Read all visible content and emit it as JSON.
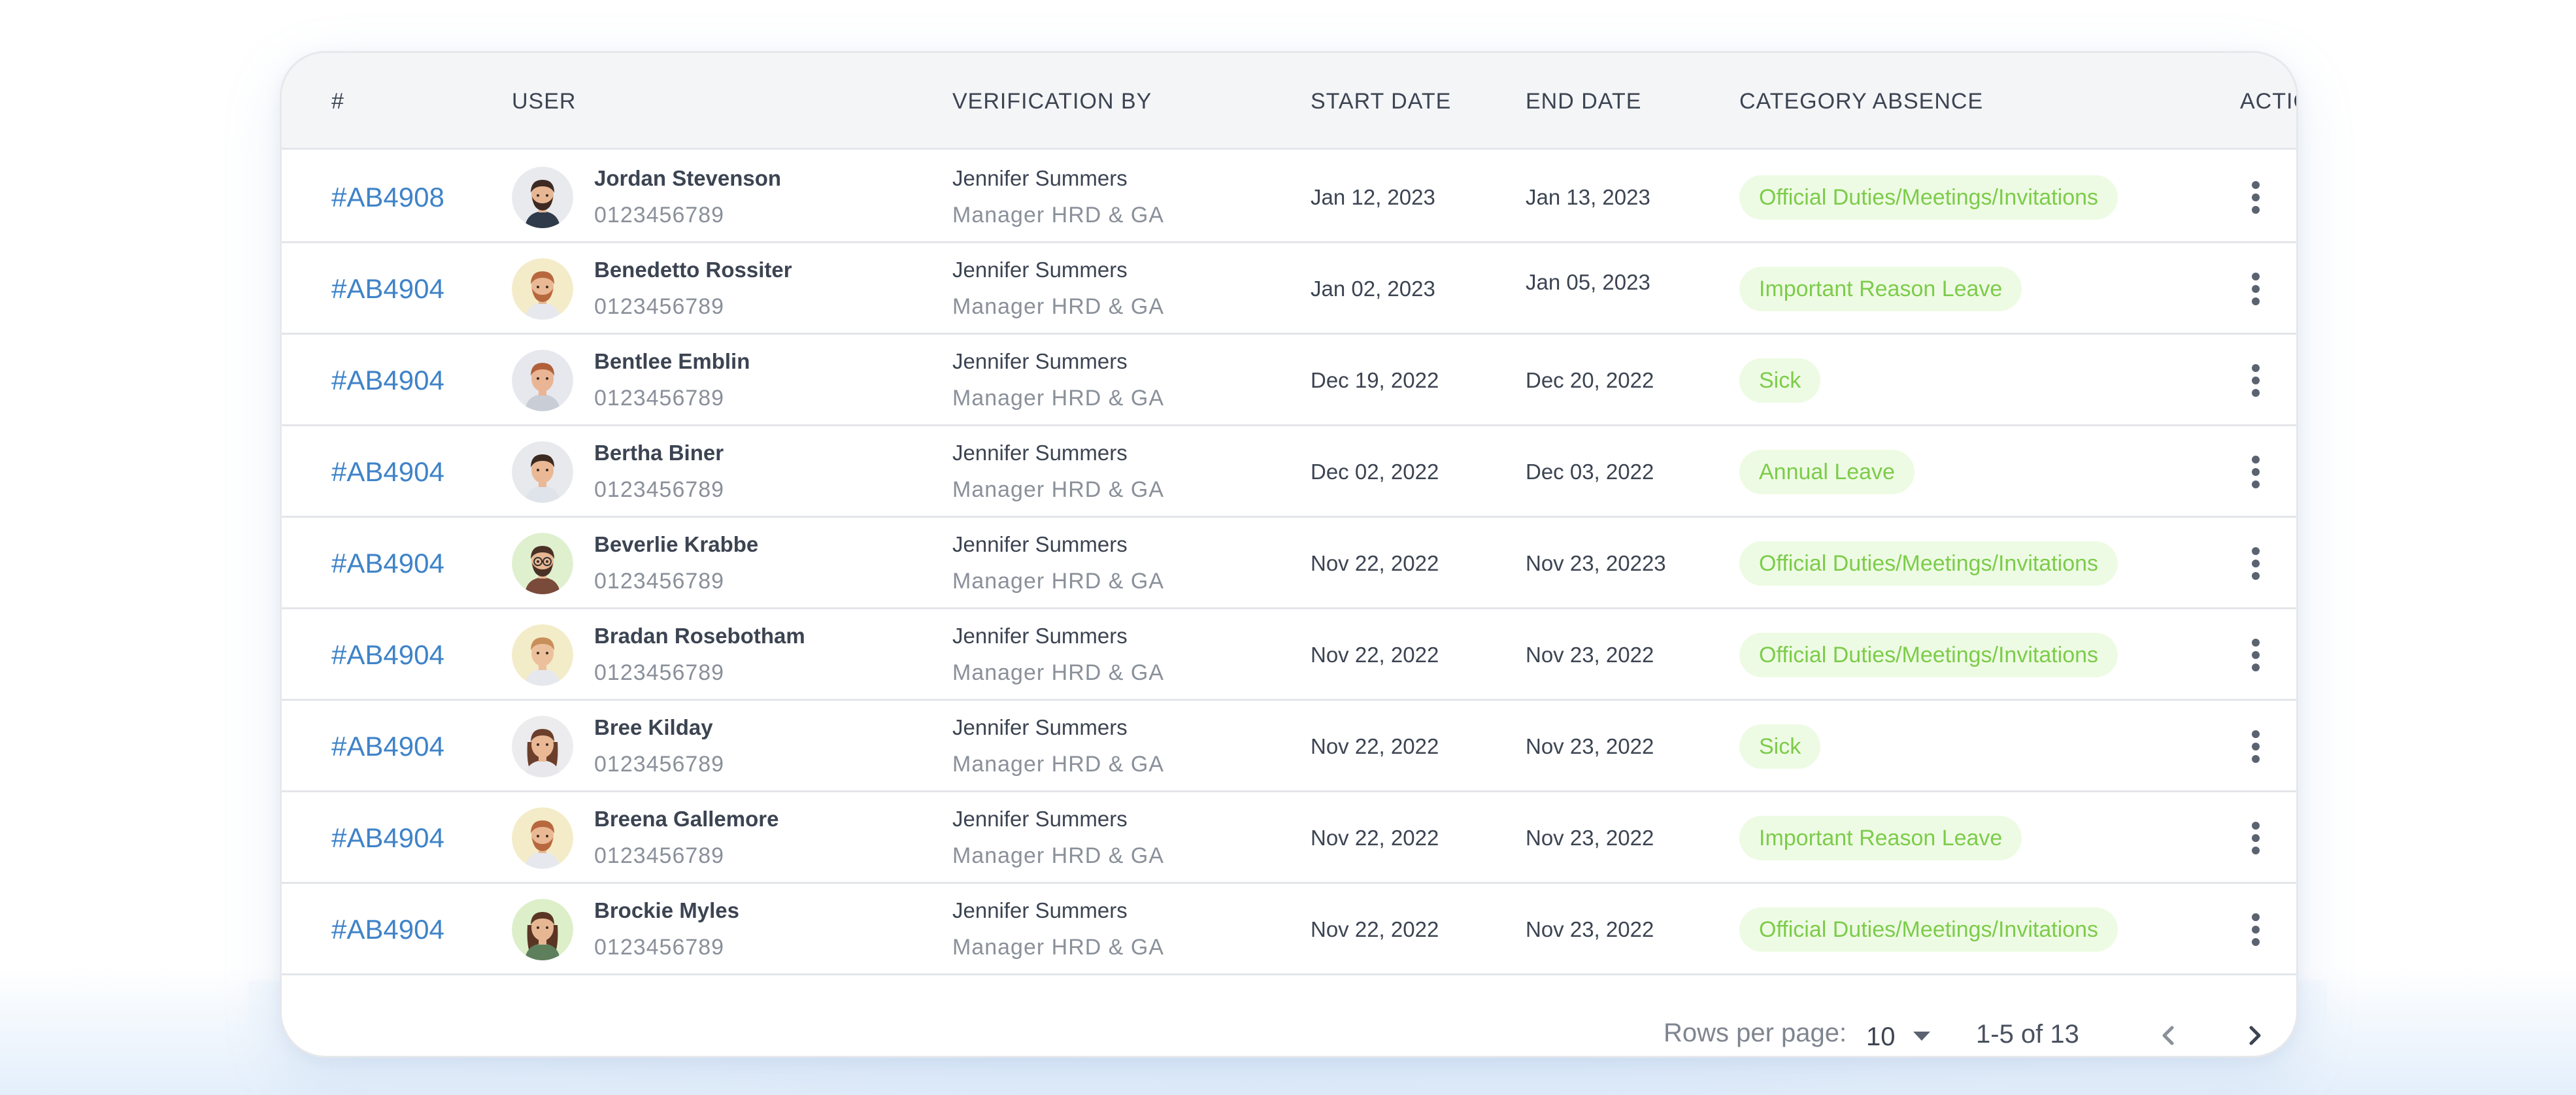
{
  "colors": {
    "accent_link": "#3f83c8",
    "badge_bg": "#eefbe4",
    "badge_text": "#7ccc4a",
    "header_bg": "#f4f5f7"
  },
  "table": {
    "columns": [
      "#",
      "USER",
      "VERIFICATION BY",
      "START DATE",
      "END DATE",
      "CATEGORY ABSENCE",
      "ACTION"
    ],
    "rows": [
      {
        "id": "#AB4908",
        "user_name": "Jordan Stevenson",
        "user_phone": "0123456789",
        "verifier_name": "Jennifer Summers",
        "verifier_role": "Manager HRD & GA",
        "start_date": "Jan 12, 2023",
        "end_date": "Jan 13, 2023",
        "category": "Official Duties/Meetings/Invitations",
        "avatar_icon": "avatar-man-beard-dark-icon"
      },
      {
        "id": "#AB4904",
        "user_name": "Benedetto Rossiter",
        "user_phone": "0123456789",
        "verifier_name": "Jennifer Summers",
        "verifier_role": "Manager HRD & GA",
        "start_date": "Jan 02, 2023",
        "end_date": "Jan 05, 2023",
        "category": "Important Reason Leave",
        "avatar_icon": "avatar-man-ginger-beard-icon"
      },
      {
        "id": "#AB4904",
        "user_name": "Bentlee Emblin",
        "user_phone": "0123456789",
        "verifier_name": "Jennifer Summers",
        "verifier_role": "Manager HRD & GA",
        "start_date": "Dec 19, 2022",
        "end_date": "Dec 20, 2022",
        "category": "Sick",
        "avatar_icon": "avatar-man-ginger-icon"
      },
      {
        "id": "#AB4904",
        "user_name": "Bertha Biner",
        "user_phone": "0123456789",
        "verifier_name": "Jennifer Summers",
        "verifier_role": "Manager HRD & GA",
        "start_date": "Dec 02, 2022",
        "end_date": "Dec 03, 2022",
        "category": "Annual Leave",
        "avatar_icon": "avatar-man-dark-hair-icon"
      },
      {
        "id": "#AB4904",
        "user_name": "Beverlie Krabbe",
        "user_phone": "0123456789",
        "verifier_name": "Jennifer Summers",
        "verifier_role": "Manager HRD & GA",
        "start_date": "Nov 22, 2022",
        "end_date": "Nov 23, 20223",
        "category": "Official Duties/Meetings/Invitations",
        "avatar_icon": "avatar-man-glasses-icon"
      },
      {
        "id": "#AB4904",
        "user_name": "Bradan Rosebotham",
        "user_phone": "0123456789",
        "verifier_name": "Jennifer Summers",
        "verifier_role": "Manager HRD & GA",
        "start_date": "Nov 22, 2022",
        "end_date": "Nov 23, 2022",
        "category": "Official Duties/Meetings/Invitations",
        "avatar_icon": "avatar-man-light-hair-icon"
      },
      {
        "id": "#AB4904",
        "user_name": "Bree Kilday",
        "user_phone": "0123456789",
        "verifier_name": "Jennifer Summers",
        "verifier_role": "Manager HRD & GA",
        "start_date": "Nov 22, 2022",
        "end_date": "Nov 23, 2022",
        "category": "Sick",
        "avatar_icon": "avatar-woman-brown-hair-icon"
      },
      {
        "id": "#AB4904",
        "user_name": "Breena Gallemore",
        "user_phone": "0123456789",
        "verifier_name": "Jennifer Summers",
        "verifier_role": "Manager HRD & GA",
        "start_date": "Nov 22, 2022",
        "end_date": "Nov 23, 2022",
        "category": "Important Reason Leave",
        "avatar_icon": "avatar-man-ginger-beard-icon"
      },
      {
        "id": "#AB4904",
        "user_name": "Brockie Myles",
        "user_phone": "0123456789",
        "verifier_name": "Jennifer Summers",
        "verifier_role": "Manager HRD & GA",
        "start_date": "Nov 22, 2022",
        "end_date": "Nov 23, 2022",
        "category": "Official Duties/Meetings/Invitations",
        "avatar_icon": "avatar-woman-long-hair-icon"
      }
    ]
  },
  "footer": {
    "rows_per_page_label": "Rows per page:",
    "rows_per_page_value": "10",
    "range_text": "1-5 of 13",
    "prev_icon": "chevron-left-icon",
    "next_icon": "chevron-right-icon"
  }
}
